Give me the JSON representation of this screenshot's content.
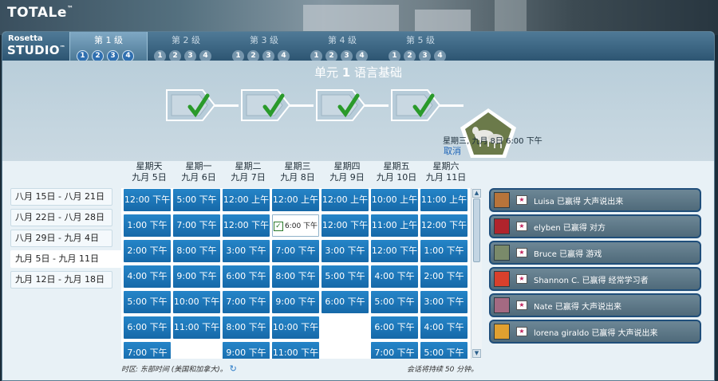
{
  "app": {
    "title": "TOTALe",
    "tm": "™"
  },
  "brand": {
    "line1": "Rosetta",
    "line2": "STUDIO",
    "tm": "™"
  },
  "levels": [
    {
      "label": "第 1 级",
      "units": [
        "1",
        "2",
        "3",
        "4"
      ],
      "active": true
    },
    {
      "label": "第 2 级",
      "units": [
        "1",
        "2",
        "3",
        "4"
      ],
      "active": false
    },
    {
      "label": "第 3 级",
      "units": [
        "1",
        "2",
        "3",
        "4"
      ],
      "active": false
    },
    {
      "label": "第 4 级",
      "units": [
        "1",
        "2",
        "3",
        "4"
      ],
      "active": false
    },
    {
      "label": "第 5 级",
      "units": [
        "1",
        "2",
        "3",
        "4"
      ],
      "active": false
    }
  ],
  "unit": {
    "prefix": "单元",
    "number": "1",
    "name": "语言基础"
  },
  "lessons": [
    {
      "done": true
    },
    {
      "done": true
    },
    {
      "done": true
    },
    {
      "done": true
    }
  ],
  "scheduled": {
    "text": "星期三, 九月 8日 6:00 下午",
    "cancel": "取消"
  },
  "weeks": [
    "八月 15日 - 八月 21日",
    "八月 22日 - 八月 28日",
    "八月 29日 - 九月 4日",
    "九月 5日 - 九月 11日",
    "九月 12日 - 九月 18日"
  ],
  "selected_week": 3,
  "days": [
    {
      "day": "星期天",
      "date": "九月 5日",
      "slots": [
        "12:00 下午",
        "1:00 下午",
        "2:00 下午",
        "4:00 下午",
        "5:00 下午",
        "6:00 下午",
        "7:00 下午"
      ]
    },
    {
      "day": "星期一",
      "date": "九月 6日",
      "slots": [
        "5:00 下午",
        "7:00 下午",
        "8:00 下午",
        "9:00 下午",
        "10:00 下午",
        "11:00 下午"
      ]
    },
    {
      "day": "星期二",
      "date": "九月 7日",
      "slots": [
        "12:00 上午",
        "12:00 下午",
        "3:00 下午",
        "6:00 下午",
        "7:00 下午",
        "8:00 下午",
        "9:00 下午"
      ]
    },
    {
      "day": "星期三",
      "date": "九月 8日",
      "slots": [
        "12:00 上午",
        "6:00 下午",
        "7:00 下午",
        "8:00 下午",
        "9:00 下午",
        "10:00 下午",
        "11:00 下午"
      ]
    },
    {
      "day": "星期四",
      "date": "九月 9日",
      "slots": [
        "12:00 上午",
        "12:00 下午",
        "3:00 下午",
        "5:00 下午",
        "6:00 下午"
      ]
    },
    {
      "day": "星期五",
      "date": "九月 10日",
      "slots": [
        "10:00 上午",
        "11:00 上午",
        "12:00 下午",
        "4:00 下午",
        "5:00 下午",
        "6:00 下午",
        "7:00 下午"
      ]
    },
    {
      "day": "星期六",
      "date": "九月 11日",
      "slots": [
        "11:00 上午",
        "12:00 下午",
        "1:00 下午",
        "2:00 下午",
        "3:00 下午",
        "4:00 下午",
        "5:00 下午"
      ]
    }
  ],
  "selected_slot": {
    "day": 3,
    "index": 1
  },
  "footer": {
    "timezone": "时区: 东部时间 (美国和加拿大)。",
    "duration": "会话将持续 50 分钟。"
  },
  "feed": [
    {
      "text": "Luisa 已赢得 大声说出来",
      "avatar_color": "#b8743a"
    },
    {
      "text": "elyben 已赢得 对方",
      "avatar_color": "#b0242c"
    },
    {
      "text": "Bruce 已赢得 游戏",
      "avatar_color": "#7a8a6a"
    },
    {
      "text": "Shannon C. 已赢得 经常学习者",
      "avatar_color": "#d8402c"
    },
    {
      "text": "Nate 已赢得 大声说出来",
      "avatar_color": "#a46a82"
    },
    {
      "text": "lorena giraldo 已赢得 大声说出来",
      "avatar_color": "#e0a030"
    }
  ],
  "colors": {
    "slot": "#1a74b9",
    "accent": "#1f65b8",
    "check": "#2a9a2a"
  }
}
